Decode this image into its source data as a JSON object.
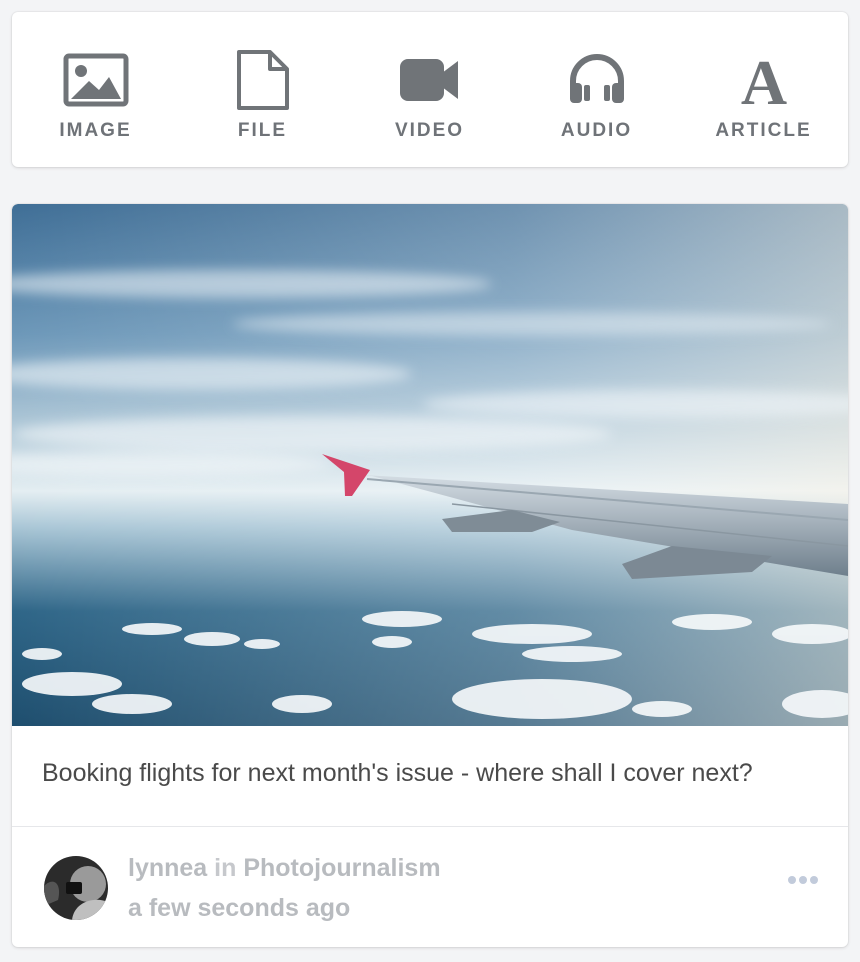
{
  "composer": {
    "buttons": [
      {
        "label": "IMAGE",
        "icon": "image-icon"
      },
      {
        "label": "FILE",
        "icon": "file-icon"
      },
      {
        "label": "VIDEO",
        "icon": "video-camera-icon"
      },
      {
        "label": "AUDIO",
        "icon": "headphones-icon"
      },
      {
        "label": "ARTICLE",
        "icon": "article-letter-a-icon"
      }
    ]
  },
  "post": {
    "image_description_icon": "photo-airplane-wing",
    "caption": "Booking flights for next month's issue - where shall I cover next?",
    "author": "lynnea",
    "in_word": "in",
    "group": "Photojournalism",
    "timestamp": "a few seconds ago",
    "more_icon": "more-dots-icon"
  },
  "colors": {
    "icon_gray": "#6f7378",
    "meta_gray": "#b8bbbf",
    "wing_tip": "#d4466a"
  }
}
